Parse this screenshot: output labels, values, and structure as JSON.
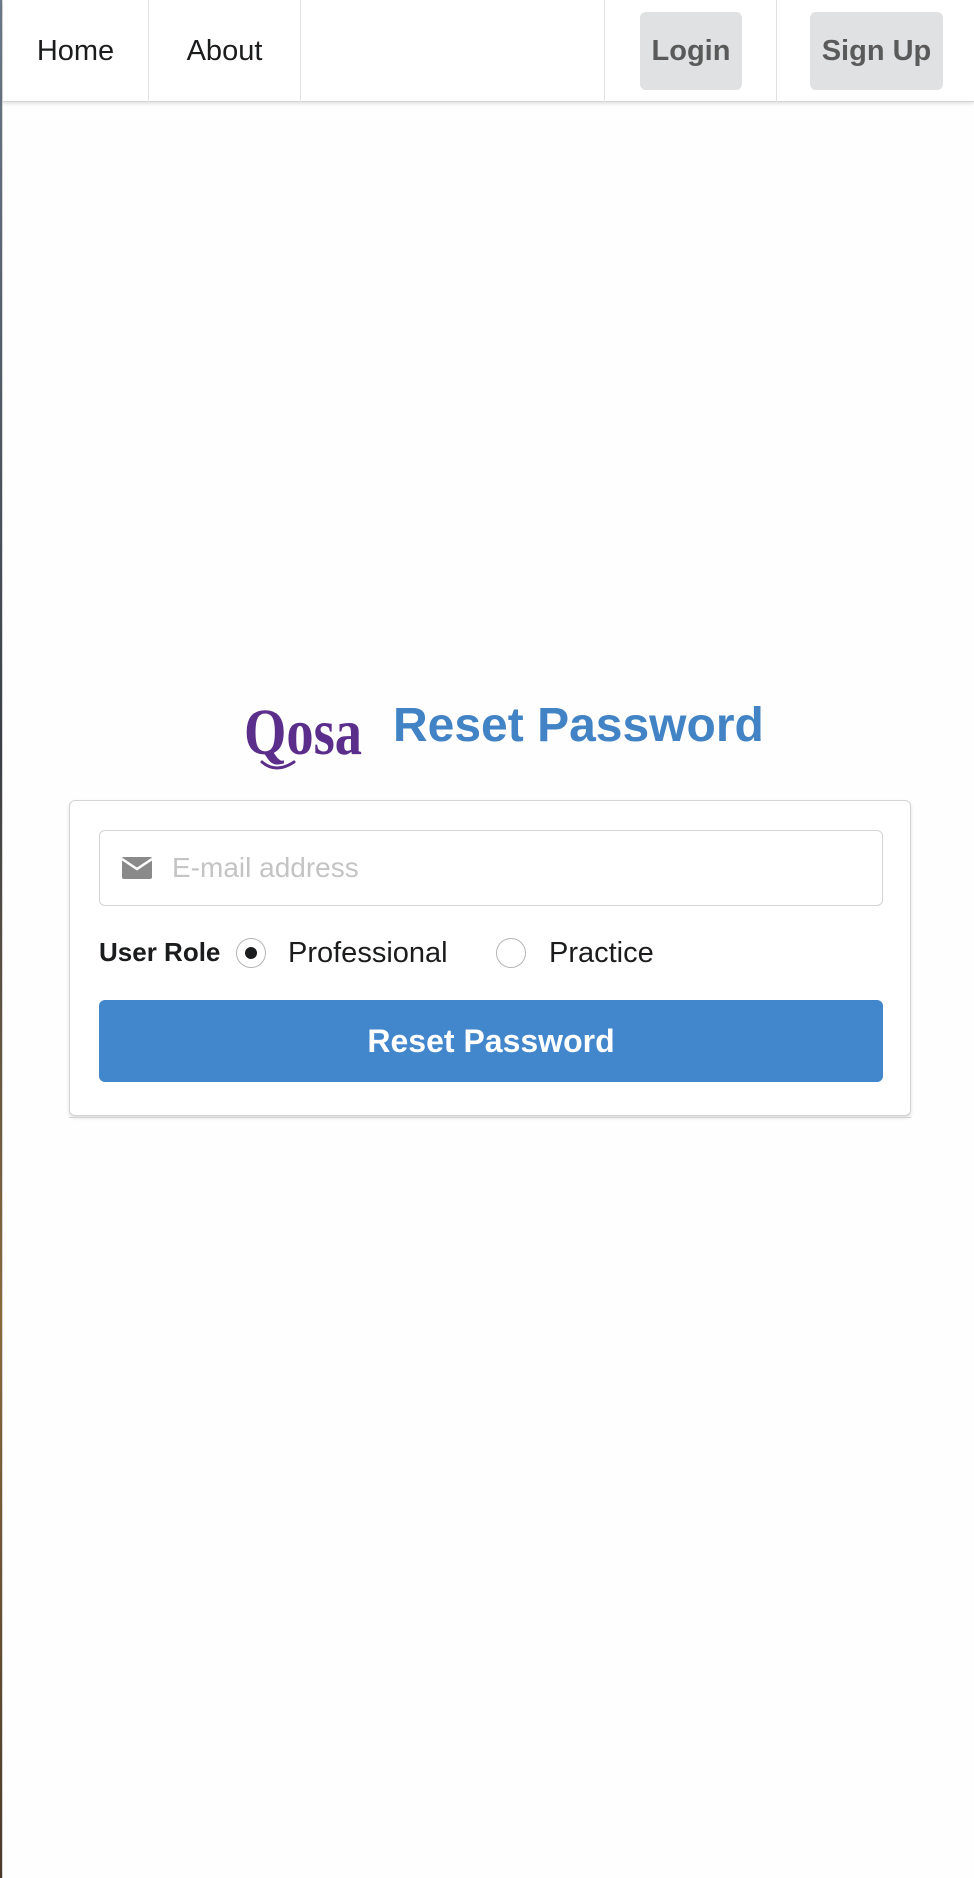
{
  "nav": {
    "home_label": "Home",
    "about_label": "About",
    "login_label": "Login",
    "signup_label": "Sign Up"
  },
  "brand": {
    "logo_text": "Qosa",
    "logo_color": "#5b2e8c"
  },
  "header": {
    "title": "Reset Password",
    "title_color": "#4183c4"
  },
  "form": {
    "email": {
      "icon": "mail-icon",
      "placeholder": "E-mail address",
      "value": ""
    },
    "user_role": {
      "label": "User Role",
      "options": [
        {
          "label": "Professional",
          "selected": true
        },
        {
          "label": "Practice",
          "selected": false
        }
      ]
    },
    "submit_label": "Reset Password",
    "submit_color": "#4286cc"
  }
}
